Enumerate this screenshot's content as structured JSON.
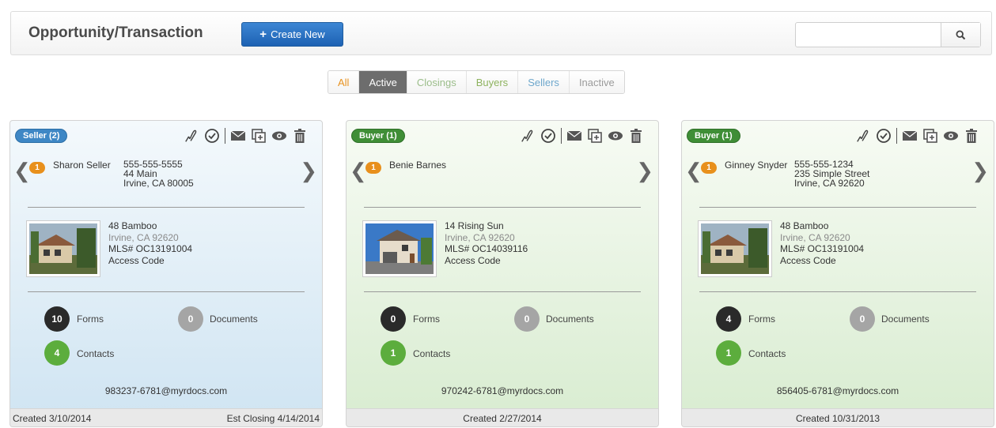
{
  "header": {
    "title": "Opportunity/Transaction",
    "create_label": "Create New",
    "search_placeholder": ""
  },
  "tabs": [
    {
      "label": "All",
      "color": "#e89322"
    },
    {
      "label": "Active",
      "color": "#ffffff"
    },
    {
      "label": "Closings",
      "color": "#9bbd8a"
    },
    {
      "label": "Buyers",
      "color": "#8eb35f"
    },
    {
      "label": "Sellers",
      "color": "#6ea7cc"
    },
    {
      "label": "Inactive",
      "color": "#9a9a9a"
    }
  ],
  "cards": [
    {
      "badge": "Seller (2)",
      "contact_count": "1",
      "contact_name": "Sharon Seller",
      "contact_lines": [
        "555-555-5555",
        "44 Main",
        "Irvine, CA 80005"
      ],
      "property": {
        "address": "48 Bamboo",
        "city": "Irvine, CA 92620",
        "mls": "MLS# OC13191004",
        "access": "Access Code"
      },
      "forms": {
        "count": "10",
        "label": "Forms"
      },
      "documents": {
        "count": "0",
        "label": "Documents"
      },
      "contacts": {
        "count": "4",
        "label": "Contacts"
      },
      "email": "983237-6781@myrdocs.com",
      "created": "Created 3/10/2014",
      "closing": "Est Closing 4/14/2014"
    },
    {
      "badge": "Buyer (1)",
      "contact_count": "1",
      "contact_name": "Benie Barnes",
      "contact_lines": [],
      "property": {
        "address": "14 Rising Sun",
        "city": "Irvine, CA 92620",
        "mls": "MLS# OC14039116",
        "access": "Access Code"
      },
      "forms": {
        "count": "0",
        "label": "Forms"
      },
      "documents": {
        "count": "0",
        "label": "Documents"
      },
      "contacts": {
        "count": "1",
        "label": "Contacts"
      },
      "email": "970242-6781@myrdocs.com",
      "created": "Created 2/27/2014"
    },
    {
      "badge": "Buyer (1)",
      "contact_count": "1",
      "contact_name": "Ginney Snyder",
      "contact_lines": [
        "555-555-1234",
        "235 Simple Street",
        "Irvine, CA 92620"
      ],
      "property": {
        "address": "48 Bamboo",
        "city": "Irvine, CA 92620",
        "mls": "MLS# OC13191004",
        "access": "Access Code"
      },
      "forms": {
        "count": "4",
        "label": "Forms"
      },
      "documents": {
        "count": "0",
        "label": "Documents"
      },
      "contacts": {
        "count": "1",
        "label": "Contacts"
      },
      "email": "856405-6781@myrdocs.com",
      "created": "Created 10/31/2013"
    }
  ],
  "icons": [
    "sign-icon",
    "clock-icon",
    "mail-icon",
    "add-copy-icon",
    "eye-icon",
    "trash-icon",
    "search-icon",
    "plus-icon",
    "chevron-left-icon",
    "chevron-right-icon",
    "house-photo-icon"
  ]
}
